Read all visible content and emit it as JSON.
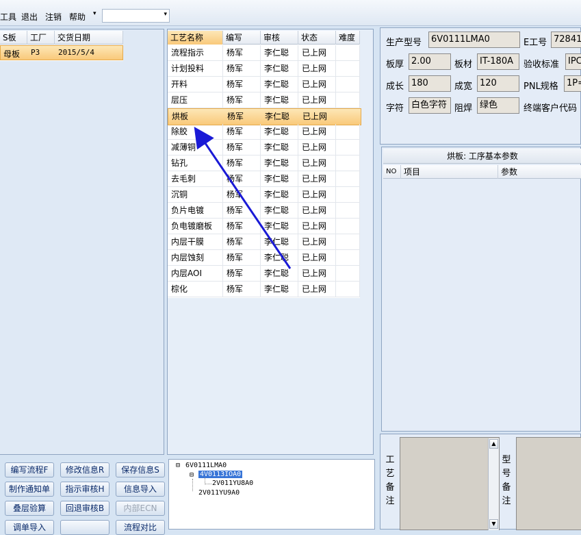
{
  "menu": {
    "items": [
      "工具",
      "退出",
      "注销",
      "帮助"
    ],
    "combo_value": ""
  },
  "order_grid": {
    "columns": [
      "S板",
      "工厂",
      "交货日期"
    ],
    "rows": [
      {
        "cells": [
          "母板",
          "P3",
          "2015/5/4"
        ],
        "selected": true
      }
    ]
  },
  "process_grid": {
    "columns": [
      "工艺名称",
      "编写",
      "审核",
      "状态",
      "难度"
    ],
    "rows": [
      {
        "cells": [
          "流程指示",
          "杨军",
          "李仁聪",
          "已上网",
          ""
        ],
        "selected": false
      },
      {
        "cells": [
          "计划投料",
          "杨军",
          "李仁聪",
          "已上网",
          ""
        ],
        "selected": false
      },
      {
        "cells": [
          "开料",
          "杨军",
          "李仁聪",
          "已上网",
          ""
        ],
        "selected": false
      },
      {
        "cells": [
          "层压",
          "杨军",
          "李仁聪",
          "已上网",
          ""
        ],
        "selected": false
      },
      {
        "cells": [
          "烘板",
          "杨军",
          "李仁聪",
          "已上网",
          ""
        ],
        "selected": true
      },
      {
        "cells": [
          "除胶",
          "杨军",
          "李仁聪",
          "已上网",
          ""
        ],
        "selected": false
      },
      {
        "cells": [
          "减薄铜",
          "杨军",
          "李仁聪",
          "已上网",
          ""
        ],
        "selected": false
      },
      {
        "cells": [
          "钻孔",
          "杨军",
          "李仁聪",
          "已上网",
          ""
        ],
        "selected": false
      },
      {
        "cells": [
          "去毛刺",
          "杨军",
          "李仁聪",
          "已上网",
          ""
        ],
        "selected": false
      },
      {
        "cells": [
          "沉铜",
          "杨军",
          "李仁聪",
          "已上网",
          ""
        ],
        "selected": false
      },
      {
        "cells": [
          "负片电镀",
          "杨军",
          "李仁聪",
          "已上网",
          ""
        ],
        "selected": false
      },
      {
        "cells": [
          "负电镀磨板",
          "杨军",
          "李仁聪",
          "已上网",
          ""
        ],
        "selected": false
      },
      {
        "cells": [
          "内层干膜",
          "杨军",
          "李仁聪",
          "已上网",
          ""
        ],
        "selected": false
      },
      {
        "cells": [
          "内层蚀刻",
          "杨军",
          "李仁聪",
          "已上网",
          ""
        ],
        "selected": false
      },
      {
        "cells": [
          "内层AOI",
          "杨军",
          "李仁聪",
          "已上网",
          ""
        ],
        "selected": false
      },
      {
        "cells": [
          "棕化",
          "杨军",
          "李仁聪",
          "已上网",
          ""
        ],
        "selected": false
      }
    ]
  },
  "buttons": [
    {
      "label": "编写流程F",
      "enabled": true
    },
    {
      "label": "修改信息R",
      "enabled": true
    },
    {
      "label": "保存信息S",
      "enabled": true
    },
    {
      "label": "制作通知单",
      "enabled": true
    },
    {
      "label": "指示审核H",
      "enabled": true
    },
    {
      "label": "信息导入",
      "enabled": true
    },
    {
      "label": "叠层验算",
      "enabled": true
    },
    {
      "label": "回退审核B",
      "enabled": true
    },
    {
      "label": "内部ECN",
      "enabled": false
    },
    {
      "label": "调单导入",
      "enabled": true
    },
    {
      "label": "",
      "enabled": true
    },
    {
      "label": "流程对比",
      "enabled": true
    }
  ],
  "tree": {
    "nodes": [
      {
        "text": "6V0111LMA0",
        "selected": false
      },
      {
        "text": "4V0113IOA0",
        "selected": true
      },
      {
        "text": "2V011YU8A0",
        "selected": false
      },
      {
        "text": "2V011YU9A0",
        "selected": false
      }
    ]
  },
  "info": {
    "model_label": "生产型号",
    "model_value": "6V0111LMA0",
    "eno_label": "E工号",
    "eno_value": "72841",
    "thickness_label": "板厚",
    "thickness_value": "2.00",
    "material_label": "板材",
    "material_value": "IT-180A",
    "accept_label": "验收标准",
    "accept_value": "IPC",
    "length_label": "成长",
    "length_value": "180",
    "width_label": "成宽",
    "width_value": "120",
    "pnl_label": "PNL规格",
    "pnl_value": "1P=",
    "char_label": "字符",
    "char_value": "白色字符",
    "mask_label": "阻焊",
    "mask_value": "绿色",
    "customer_label": "终端客户代码"
  },
  "params": {
    "title": "烘板: 工序基本参数",
    "columns": [
      "NO",
      "项目",
      "参数"
    ]
  },
  "notes": {
    "process_note_label": "工艺备注",
    "model_note_label": "型号备注"
  },
  "colors": {
    "background": "#d6e4f3",
    "selection": "#f9c97a",
    "annotation_arrow": "#1a1ad6"
  }
}
